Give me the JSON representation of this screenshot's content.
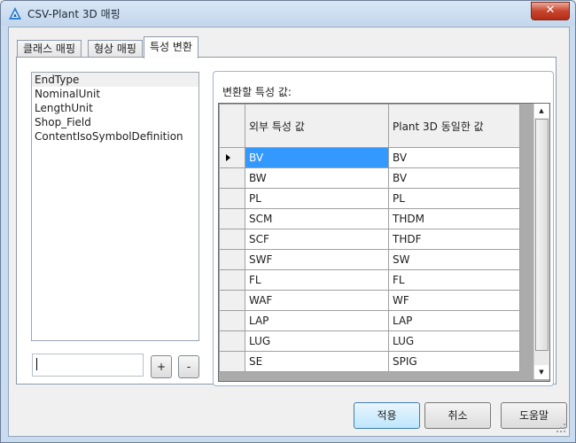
{
  "window": {
    "title": "CSV-Plant 3D 매핑",
    "close_glyph": "✕"
  },
  "tabs": [
    {
      "label": "클래스 매핑",
      "active": false
    },
    {
      "label": "형상 매핑",
      "active": false
    },
    {
      "label": "특성 변환",
      "active": true
    }
  ],
  "property_list": {
    "items": [
      "EndType",
      "NominalUnit",
      "LengthUnit",
      "Shop_Field",
      "ContentIsoSymbolDefinition"
    ],
    "selected_index": 0
  },
  "new_value_input": {
    "value": ""
  },
  "add_button": {
    "label": "+"
  },
  "remove_button": {
    "label": "-"
  },
  "conversion": {
    "group_label": "변환할 특성 값:",
    "columns": [
      "외부 특성 값",
      "Plant 3D 동일한 값"
    ],
    "rows": [
      [
        "BV",
        "BV"
      ],
      [
        "BW",
        "BV"
      ],
      [
        "PL",
        "PL"
      ],
      [
        "SCM",
        "THDM"
      ],
      [
        "SCF",
        "THDF"
      ],
      [
        "SWF",
        "SW"
      ],
      [
        "FL",
        "FL"
      ],
      [
        "WAF",
        "WF"
      ],
      [
        "LAP",
        "LAP"
      ],
      [
        "LUG",
        "LUG"
      ],
      [
        "SE",
        "SPIG"
      ]
    ],
    "selected_row": 0
  },
  "footer": {
    "apply_label": "적용",
    "cancel_label": "취소",
    "help_label": "도움말"
  },
  "icons": {
    "app": "autocad-plant-logo-icon",
    "scroll_up": "triangle-up-icon",
    "scroll_down": "triangle-down-icon",
    "row_pointer": "row-pointer-icon"
  },
  "colors": {
    "selection": "#3399ff",
    "close_button": "#c8442e",
    "title_bar": "#c9dbee"
  }
}
